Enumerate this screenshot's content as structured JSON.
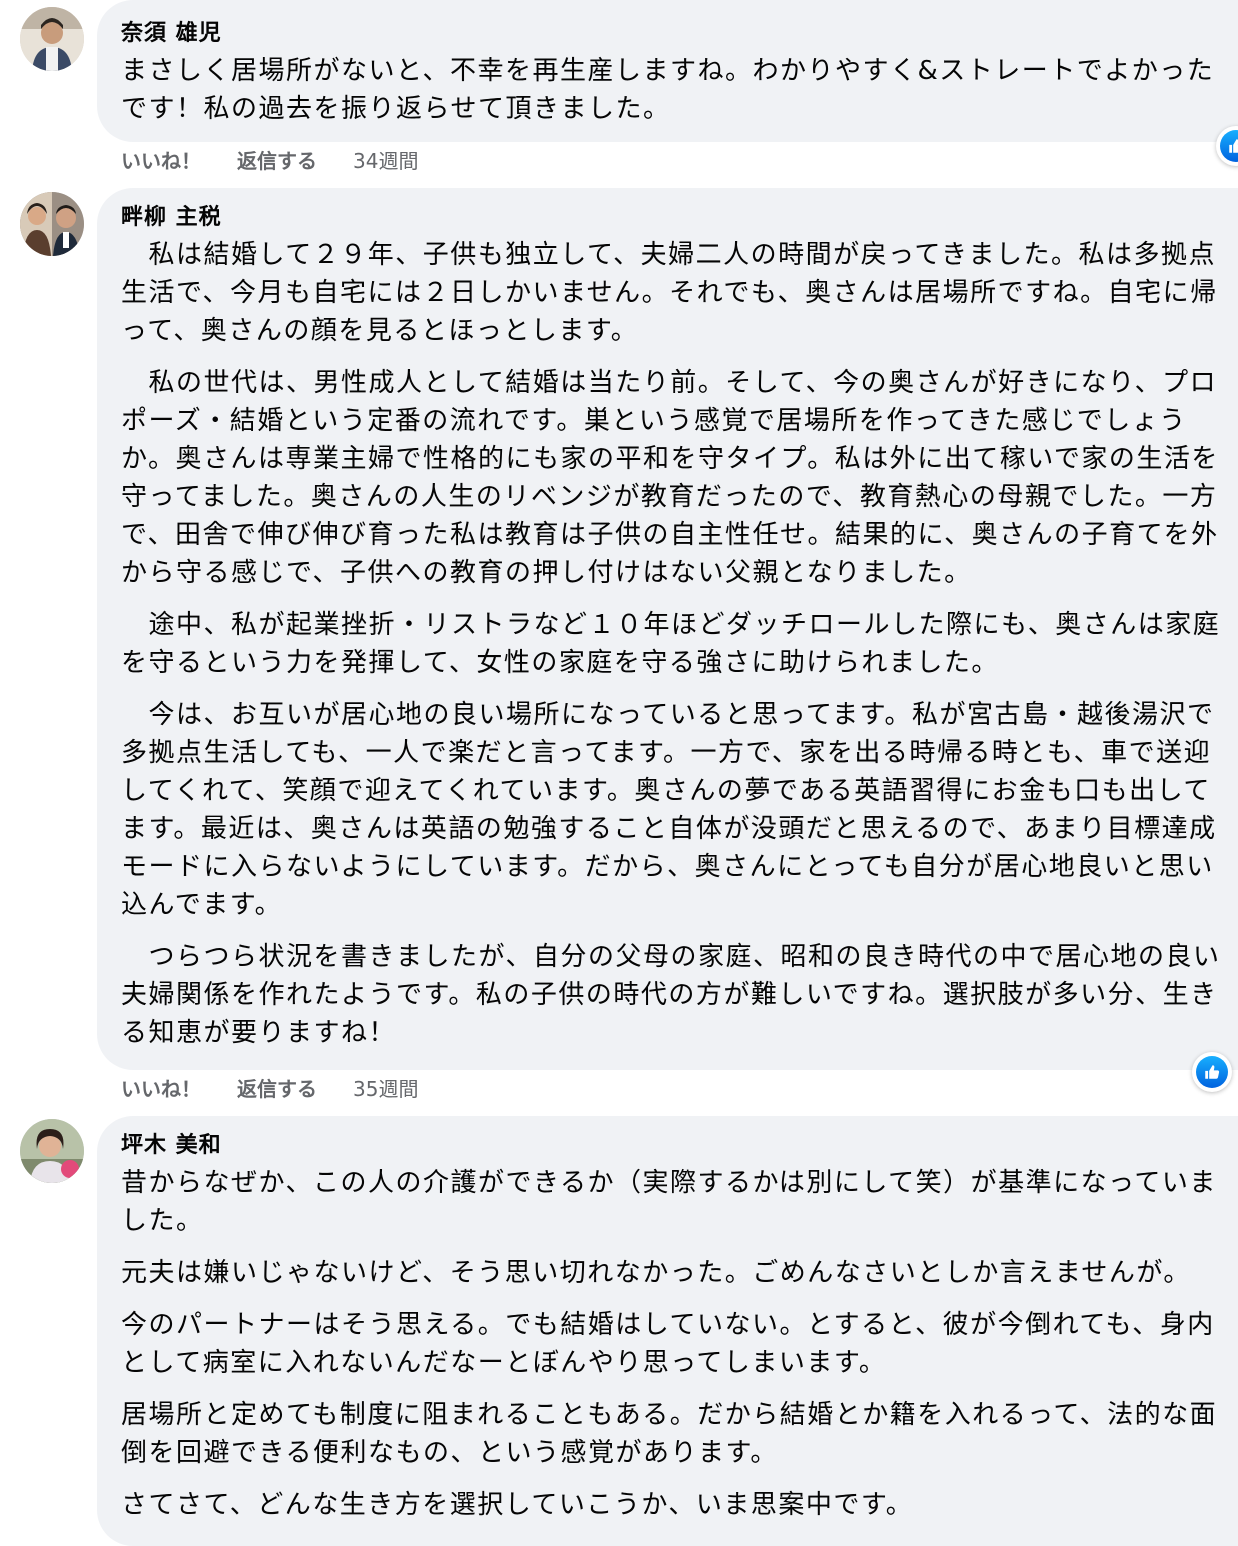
{
  "comments": [
    {
      "author": "奈須 雄児",
      "paragraphs": [
        "まさしく居場所がないと、不幸を再生産しますね。わかりやすく&ストレートでよかったです！私の過去を振り返らせて頂きました。"
      ],
      "actions": {
        "like": "いいね！",
        "reply": "返信する",
        "time": "34週間"
      }
    },
    {
      "author": "畔柳 主税",
      "paragraphs": [
        "　私は結婚して２９年、子供も独立して、夫婦二人の時間が戻ってきました。私は多拠点生活で、今月も自宅には２日しかいません。それでも、奥さんは居場所ですね。自宅に帰って、奥さんの顔を見るとほっとします。",
        "　私の世代は、男性成人として結婚は当たり前。そして、今の奥さんが好きになり、プロポーズ・結婚という定番の流れです。巣という感覚で居場所を作ってきた感じでしょうか。奥さんは専業主婦で性格的にも家の平和を守タイプ。私は外に出て稼いで家の生活を守ってました。奥さんの人生のリベンジが教育だったので、教育熱心の母親でした。一方で、田舎で伸び伸び育った私は教育は子供の自主性任せ。結果的に、奥さんの子育てを外から守る感じで、子供への教育の押し付けはない父親となりました。",
        "　途中、私が起業挫折・リストラなど１０年ほどダッチロールした際にも、奥さんは家庭を守るという力を発揮して、女性の家庭を守る強さに助けられました。",
        "　今は、お互いが居心地の良い場所になっていると思ってます。私が宮古島・越後湯沢で多拠点生活しても、一人で楽だと言ってます。一方で、家を出る時帰る時とも、車で送迎してくれて、笑顔で迎えてくれています。奥さんの夢である英語習得にお金も口も出してます。最近は、奥さんは英語の勉強すること自体が没頭だと思えるので、あまり目標達成モードに入らないようにしています。だから、奥さんにとっても自分が居心地良いと思い込んでます。",
        "　つらつら状況を書きましたが、自分の父母の家庭、昭和の良き時代の中で居心地の良い夫婦関係を作れたようです。私の子供の時代の方が難しいですね。選択肢が多い分、生きる知恵が要りますね！"
      ],
      "actions": {
        "like": "いいね！",
        "reply": "返信する",
        "time": "35週間"
      }
    },
    {
      "author": "坪木 美和",
      "paragraphs": [
        "昔からなぜか、この人の介護ができるか（実際するかは別にして笑）が基準になっていました。",
        "元夫は嫌いじゃないけど、そう思い切れなかった。ごめんなさいとしか言えませんが。",
        "今のパートナーはそう思える。でも結婚はしていない。とすると、彼が今倒れても、身内として病室に入れないんだなーとぼんやり思ってしまいます。",
        "居場所と定めても制度に阻まれることもある。だから結婚とか籍を入れるって、法的な面倒を回避できる便利なもの、という感覚があります。",
        "さてさて、どんな生き方を選択していこうか、いま思案中です。"
      ]
    }
  ],
  "colors": {
    "bubble": "#f0f2f5",
    "meta": "#65676b",
    "like_blue": "#0866ff"
  },
  "icons": [
    "avatar-photo",
    "thumbs-up-icon"
  ]
}
